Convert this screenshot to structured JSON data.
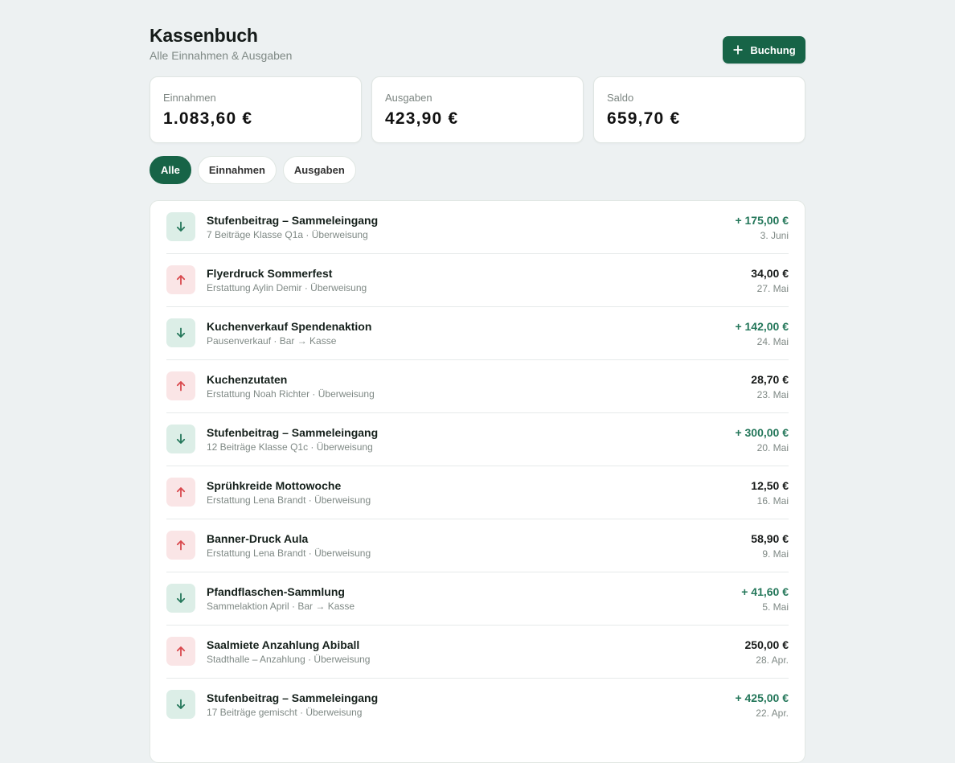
{
  "header": {
    "title": "Kassenbuch",
    "subtitle": "Alle Einnahmen & Ausgaben",
    "add_button_label": "Buchung",
    "add_button_icon": "plus-icon"
  },
  "summary": [
    {
      "label": "Einnahmen",
      "value": "1.083,60 €"
    },
    {
      "label": "Ausgaben",
      "value": "423,90 €"
    },
    {
      "label": "Saldo",
      "value": "659,70 €"
    }
  ],
  "filters": [
    {
      "label": "Alle",
      "selected": true
    },
    {
      "label": "Einnahmen",
      "selected": false
    },
    {
      "label": "Ausgaben",
      "selected": false
    }
  ],
  "transactions": [
    {
      "type": "income",
      "icon": "arrow-down-icon",
      "title": "Stufenbeitrag – Sammeleingang",
      "meta": "7 Beiträge Klasse Q1a · Überweisung",
      "amount": "+ 175,00 €",
      "date": "3. Juni"
    },
    {
      "type": "expense",
      "icon": "arrow-up-icon",
      "title": "Flyerdruck Sommerfest",
      "meta": "Erstattung Aylin Demir · Überweisung",
      "amount": "34,00 €",
      "date": "27. Mai"
    },
    {
      "type": "income",
      "icon": "arrow-down-icon",
      "title": "Kuchenverkauf Spendenaktion",
      "meta": "Pausenverkauf · Bar → Kasse",
      "amount": "+ 142,00 €",
      "date": "24. Mai"
    },
    {
      "type": "expense",
      "icon": "arrow-up-icon",
      "title": "Kuchenzutaten",
      "meta": "Erstattung Noah Richter · Überweisung",
      "amount": "28,70 €",
      "date": "23. Mai"
    },
    {
      "type": "income",
      "icon": "arrow-down-icon",
      "title": "Stufenbeitrag – Sammeleingang",
      "meta": "12 Beiträge Klasse Q1c · Überweisung",
      "amount": "+ 300,00 €",
      "date": "20. Mai"
    },
    {
      "type": "expense",
      "icon": "arrow-up-icon",
      "title": "Sprühkreide Mottowoche",
      "meta": "Erstattung Lena Brandt · Überweisung",
      "amount": "12,50 €",
      "date": "16. Mai"
    },
    {
      "type": "expense",
      "icon": "arrow-up-icon",
      "title": "Banner-Druck Aula",
      "meta": "Erstattung Lena Brandt · Überweisung",
      "amount": "58,90 €",
      "date": "9. Mai"
    },
    {
      "type": "income",
      "icon": "arrow-down-icon",
      "title": "Pfandflaschen-Sammlung",
      "meta": "Sammelaktion April · Bar → Kasse",
      "amount": "+ 41,60 €",
      "date": "5. Mai"
    },
    {
      "type": "expense",
      "icon": "arrow-up-icon",
      "title": "Saalmiete Anzahlung Abiball",
      "meta": "Stadthalle – Anzahlung · Überweisung",
      "amount": "250,00 €",
      "date": "28. Apr."
    },
    {
      "type": "income",
      "icon": "arrow-down-icon",
      "title": "Stufenbeitrag – Sammeleingang",
      "meta": "17 Beiträge gemischt · Überweisung",
      "amount": "+ 425,00 €",
      "date": "22. Apr."
    }
  ],
  "colors": {
    "background": "#edf1f2",
    "accent": "#176447",
    "income": "#24775a",
    "expense_icon": "#d9484d"
  }
}
